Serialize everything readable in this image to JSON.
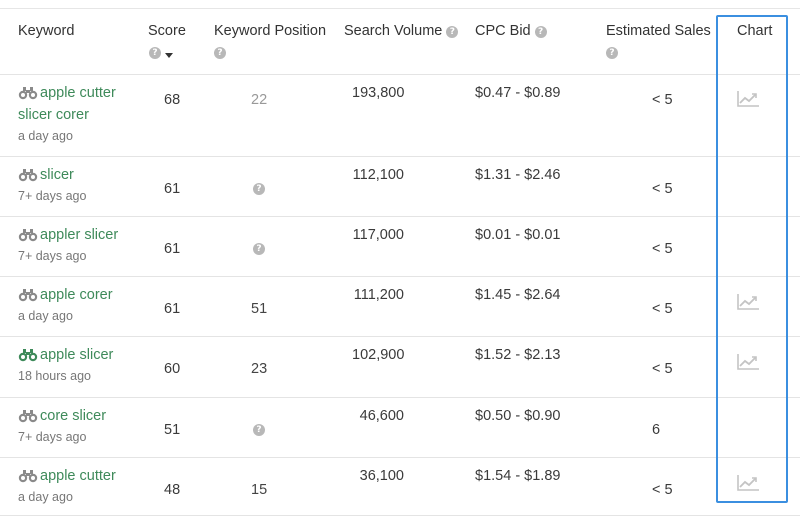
{
  "columns": {
    "keyword": "Keyword",
    "score": "Score",
    "keyword_position": "Keyword Position",
    "search_volume": "Search Volume",
    "cpc_bid": "CPC Bid",
    "estimated_sales": "Estimated Sales",
    "chart": "Chart"
  },
  "icons": {
    "help": "question-circle-icon",
    "sort": "caret-down-icon",
    "keyword": "binoculars-icon",
    "chart": "line-chart-icon"
  },
  "help_glyph": "?",
  "colors": {
    "keyword_link": "#3e8a5a",
    "highlight": "#3b8fe0",
    "binoculars_active": "#3e8a5a",
    "binoculars_inactive": "#8a8a8a"
  },
  "rows": [
    {
      "keyword_line1": "apple cutter",
      "keyword_line2": "slicer corer",
      "time": "a day ago",
      "score": "68",
      "position": "22",
      "position_shown": true,
      "search_volume": "193,800",
      "cpc_bid": "$0.47 - $0.89",
      "estimated_sales": "< 5",
      "has_chart": true,
      "binoculars_active": false
    },
    {
      "keyword_line1": "slicer",
      "keyword_line2": "",
      "time": "7+ days ago",
      "score": "61",
      "position": "",
      "position_shown": false,
      "search_volume": "112,100",
      "cpc_bid": "$1.31 - $2.46",
      "estimated_sales": "< 5",
      "has_chart": false,
      "binoculars_active": false
    },
    {
      "keyword_line1": "appler slicer",
      "keyword_line2": "",
      "time": "7+ days ago",
      "score": "61",
      "position": "",
      "position_shown": false,
      "search_volume": "117,000",
      "cpc_bid": "$0.01 - $0.01",
      "estimated_sales": "< 5",
      "has_chart": false,
      "binoculars_active": false
    },
    {
      "keyword_line1": "apple corer",
      "keyword_line2": "",
      "time": "a day ago",
      "score": "61",
      "position": "51",
      "position_shown": true,
      "search_volume": "111,200",
      "cpc_bid": "$1.45 - $2.64",
      "estimated_sales": "< 5",
      "has_chart": true,
      "binoculars_active": false
    },
    {
      "keyword_line1": "apple slicer",
      "keyword_line2": "",
      "time": "18 hours ago",
      "score": "60",
      "position": "23",
      "position_shown": true,
      "search_volume": "102,900",
      "cpc_bid": "$1.52 - $2.13",
      "estimated_sales": "< 5",
      "has_chart": true,
      "binoculars_active": true
    },
    {
      "keyword_line1": "core slicer",
      "keyword_line2": "",
      "time": "7+ days ago",
      "score": "51",
      "position": "",
      "position_shown": false,
      "search_volume": "46,600",
      "cpc_bid": "$0.50 - $0.90",
      "estimated_sales": "6",
      "has_chart": false,
      "binoculars_active": false
    },
    {
      "keyword_line1": "apple cutter",
      "keyword_line2": "",
      "time": "a day ago",
      "score": "48",
      "position": "15",
      "position_shown": true,
      "search_volume": "36,100",
      "cpc_bid": "$1.54 - $1.89",
      "estimated_sales": "< 5",
      "has_chart": true,
      "binoculars_active": false
    }
  ]
}
